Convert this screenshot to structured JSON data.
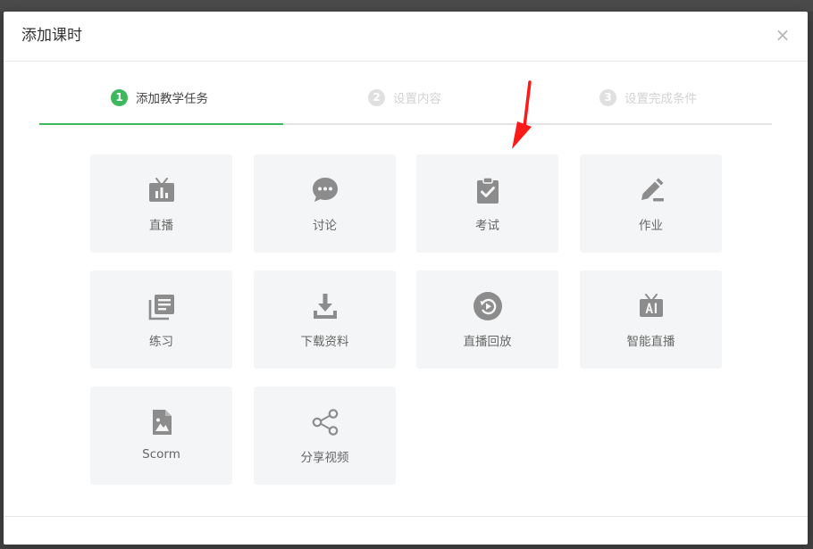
{
  "modal": {
    "title": "添加课时",
    "close_label": "×"
  },
  "steps": [
    {
      "number": "1",
      "label": "添加教学任务",
      "state": "active"
    },
    {
      "number": "2",
      "label": "设置内容",
      "state": "inactive"
    },
    {
      "number": "3",
      "label": "设置完成条件",
      "state": "inactive"
    }
  ],
  "tasks": [
    {
      "label": "直播",
      "icon": "live-tv-icon"
    },
    {
      "label": "讨论",
      "icon": "chat-bubble-icon"
    },
    {
      "label": "考试",
      "icon": "clipboard-check-icon"
    },
    {
      "label": "作业",
      "icon": "pencil-edit-icon"
    },
    {
      "label": "练习",
      "icon": "stacked-pages-icon"
    },
    {
      "label": "下载资料",
      "icon": "download-icon"
    },
    {
      "label": "直播回放",
      "icon": "replay-icon"
    },
    {
      "label": "智能直播",
      "icon": "ai-tv-icon"
    },
    {
      "label": "Scorm",
      "icon": "image-file-icon"
    },
    {
      "label": "分享视频",
      "icon": "share-icon"
    }
  ],
  "colors": {
    "accent": "#3db85c",
    "tile_bg": "#f4f5f6",
    "icon": "#8c8c8c",
    "annotation_arrow": "#ff1a1a"
  }
}
